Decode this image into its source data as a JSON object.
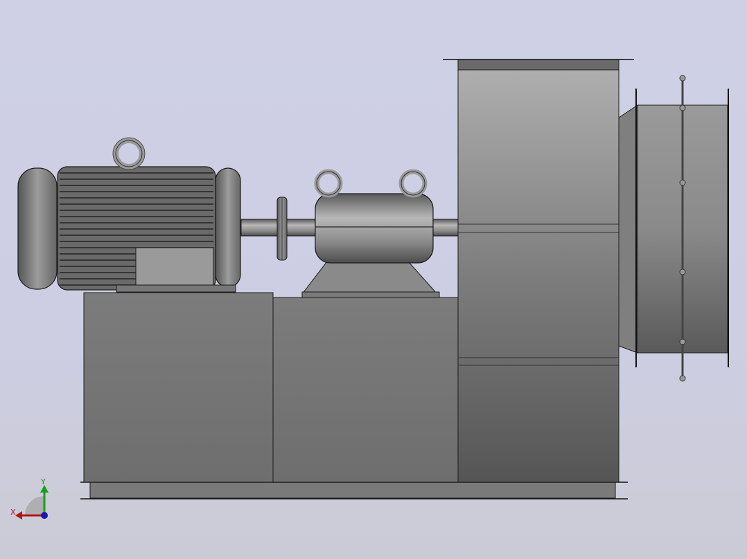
{
  "viewport": {
    "background_top": "#cfd0e6",
    "background_bottom": "#cbcbd6"
  },
  "triad": {
    "x_label": "X",
    "y_label": "Y",
    "x_color": "#b01818",
    "y_color": "#18a018",
    "z_color": "#1818b0"
  },
  "model": {
    "parts": [
      "electric-motor",
      "shaft-coupling",
      "bearing-housing",
      "fan-casing",
      "inlet-duct",
      "base-frame"
    ]
  }
}
